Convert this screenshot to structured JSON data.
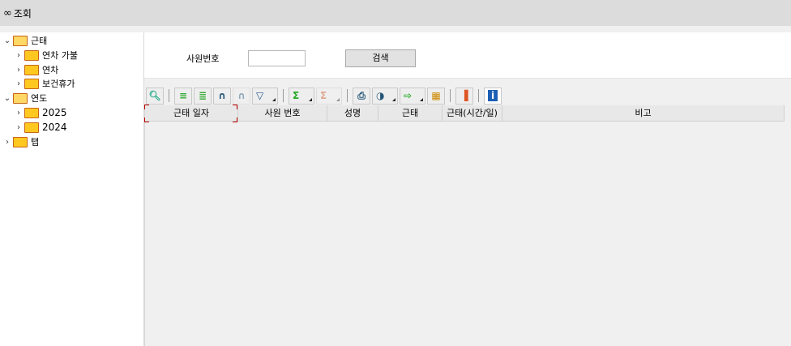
{
  "title": {
    "icon": "glasses-icon",
    "label": "조회"
  },
  "tree": [
    {
      "label": "근태",
      "level": 0,
      "open": true
    },
    {
      "label": "연차 가불",
      "level": 1,
      "open": false
    },
    {
      "label": "연차",
      "level": 1,
      "open": false
    },
    {
      "label": "보건휴가",
      "level": 1,
      "open": false
    },
    {
      "label": "연도",
      "level": 0,
      "open": true
    },
    {
      "label": "2025",
      "level": 1,
      "open": false
    },
    {
      "label": "2024",
      "level": 1,
      "open": false
    },
    {
      "label": "탭",
      "level": 0,
      "open": false
    }
  ],
  "form": {
    "employee_no_label": "사원번호",
    "employee_no_value": "",
    "search_label": "검색"
  },
  "toolbar": [
    "zoom-preview",
    "align-top",
    "align-center",
    "find",
    "find-add",
    "filter",
    "sum",
    "clear-sum",
    "print",
    "export",
    "export-file",
    "grid-layout",
    "chart",
    "info"
  ],
  "grid": {
    "columns": [
      "근태 일자",
      "사원 번호",
      "성명",
      "근태",
      "근태(시간/일)",
      "비고"
    ]
  }
}
